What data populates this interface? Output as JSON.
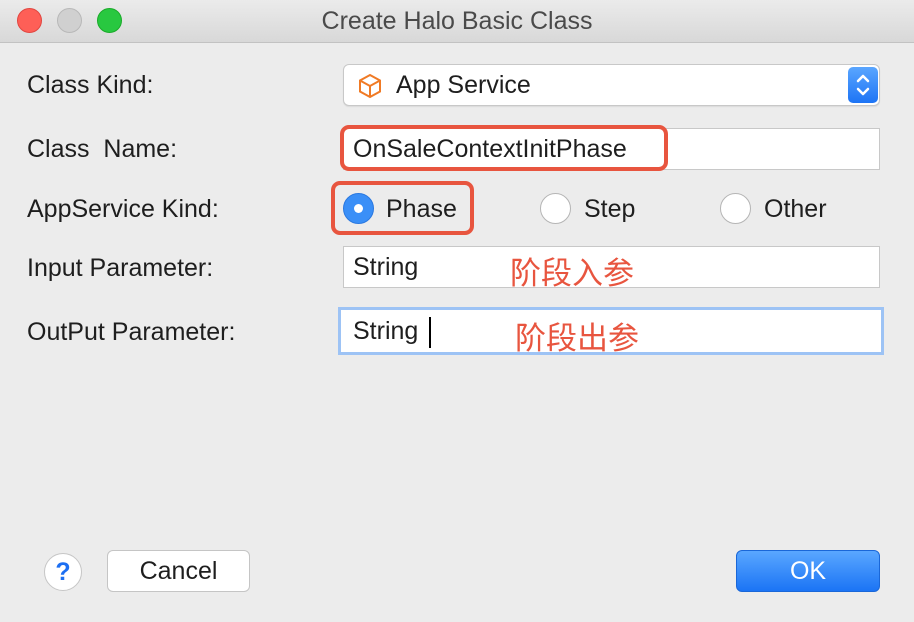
{
  "window": {
    "title": "Create Halo Basic Class"
  },
  "form": {
    "class_kind_label": "Class Kind:",
    "class_kind_value": "App Service",
    "class_name_label": "Class  Name:",
    "class_name_value": "OnSaleContextInitPhase",
    "appservice_kind_label": "AppService Kind:",
    "appservice_kind_options": [
      "Phase",
      "Step",
      "Other"
    ],
    "appservice_kind_selected": "Phase",
    "input_param_label": "Input Parameter:",
    "input_param_value": "String",
    "output_param_label": "OutPut Parameter:",
    "output_param_value": "String"
  },
  "annotations": {
    "input_note": "阶段入参",
    "output_note": "阶段出参",
    "color": "#e8553f"
  },
  "footer": {
    "help_label": "?",
    "cancel_label": "Cancel",
    "ok_label": "OK"
  },
  "colors": {
    "accent": "#1d74f5",
    "highlight": "#e8553f",
    "focus_ring": "#9dc3f5"
  }
}
